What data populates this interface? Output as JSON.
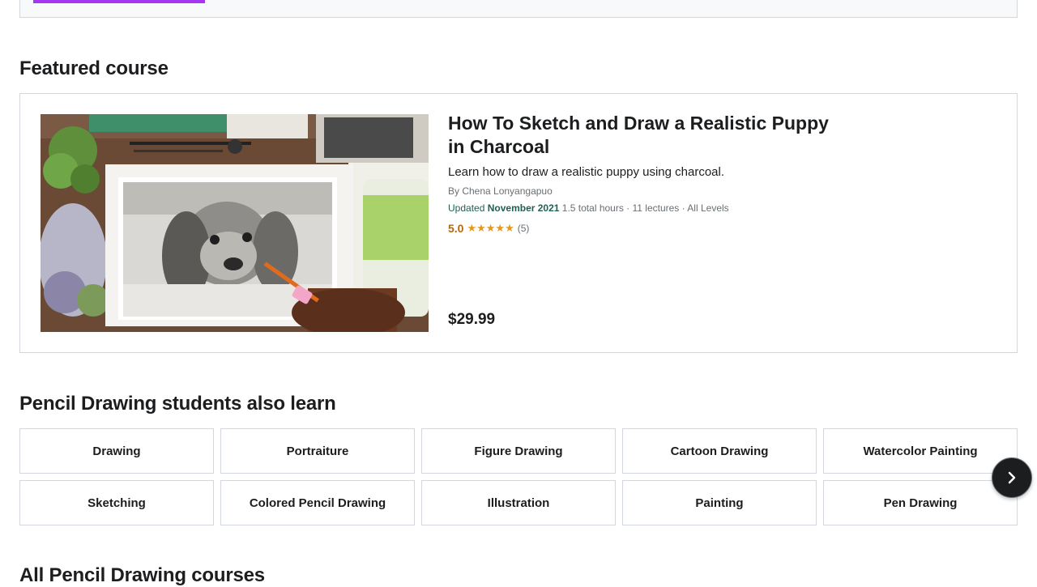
{
  "featured": {
    "heading": "Featured course",
    "course": {
      "title": "How To Sketch and Draw a Realistic Puppy in Charcoal",
      "headline": "Learn how to draw a realistic puppy using charcoal.",
      "instructor": "By Chena Lonyangapuo",
      "updated_label": "Updated",
      "updated_date": "November 2021",
      "details": "1.5 total hours · 11 lectures · All Levels",
      "rating": "5.0",
      "stars": "★★★★★",
      "rating_count": "(5)",
      "rating_value": 5.0,
      "price": "$29.99",
      "thumbnail_icon": "course-thumbnail-image"
    }
  },
  "related": {
    "heading": "Pencil Drawing students also learn",
    "topics_row1": [
      "Drawing",
      "Portraiture",
      "Figure Drawing",
      "Cartoon Drawing",
      "Watercolor Painting"
    ],
    "topics_row2": [
      "Sketching",
      "Colored Pencil Drawing",
      "Illustration",
      "Painting",
      "Pen Drawing"
    ],
    "next_icon": "chevron-right-icon"
  },
  "all_courses": {
    "heading": "All Pencil Drawing courses"
  },
  "colors": {
    "accent": "#a435f0",
    "text": "#1c1d1f",
    "rating": "#b4690e",
    "star": "#e59819",
    "updated": "#1e6055",
    "border": "#d1d7dc"
  }
}
